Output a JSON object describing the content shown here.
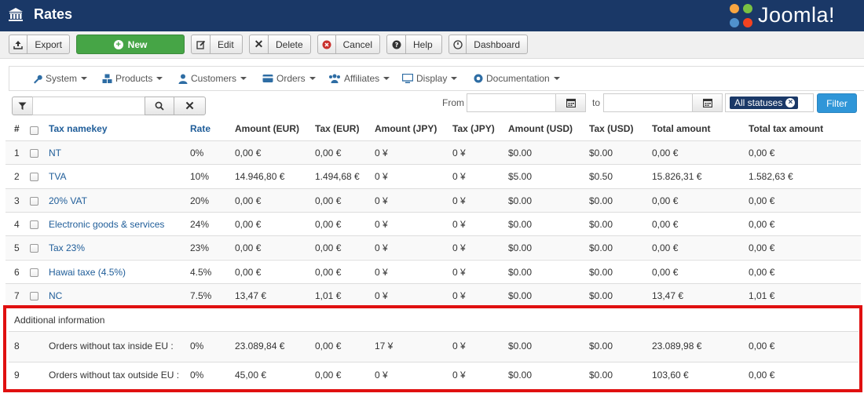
{
  "header": {
    "title": "Rates",
    "logo_text": "Joomla!"
  },
  "toolbar": {
    "export": "Export",
    "new": "New",
    "edit": "Edit",
    "delete": "Delete",
    "cancel": "Cancel",
    "help": "Help",
    "dashboard": "Dashboard"
  },
  "menu": {
    "system": "System",
    "products": "Products",
    "customers": "Customers",
    "orders": "Orders",
    "affiliates": "Affiliates",
    "display": "Display",
    "documentation": "Documentation"
  },
  "filters": {
    "search_value": "",
    "from_label": "From",
    "to_label": "to",
    "from_value": "",
    "to_value": "",
    "status_chip": "All statuses",
    "filter_button": "Filter"
  },
  "table": {
    "columns": [
      "#",
      "Tax namekey",
      "Rate",
      "Amount (EUR)",
      "Tax (EUR)",
      "Amount (JPY)",
      "Tax (JPY)",
      "Amount (USD)",
      "Tax (USD)",
      "Total amount",
      "Total tax amount"
    ],
    "rows": [
      [
        "1",
        "NT",
        "0%",
        "0,00 €",
        "0,00 €",
        "0 ¥",
        "0 ¥",
        "$0.00",
        "$0.00",
        "0,00 €",
        "0,00 €"
      ],
      [
        "2",
        "TVA",
        "10%",
        "14.946,80 €",
        "1.494,68 €",
        "0 ¥",
        "0 ¥",
        "$5.00",
        "$0.50",
        "15.826,31 €",
        "1.582,63 €"
      ],
      [
        "3",
        "20% VAT",
        "20%",
        "0,00 €",
        "0,00 €",
        "0 ¥",
        "0 ¥",
        "$0.00",
        "$0.00",
        "0,00 €",
        "0,00 €"
      ],
      [
        "4",
        "Electronic goods & services",
        "24%",
        "0,00 €",
        "0,00 €",
        "0 ¥",
        "0 ¥",
        "$0.00",
        "$0.00",
        "0,00 €",
        "0,00 €"
      ],
      [
        "5",
        "Tax 23%",
        "23%",
        "0,00 €",
        "0,00 €",
        "0 ¥",
        "0 ¥",
        "$0.00",
        "$0.00",
        "0,00 €",
        "0,00 €"
      ],
      [
        "6",
        "Hawai taxe (4.5%)",
        "4.5%",
        "0,00 €",
        "0,00 €",
        "0 ¥",
        "0 ¥",
        "$0.00",
        "$0.00",
        "0,00 €",
        "0,00 €"
      ],
      [
        "7",
        "NC",
        "7.5%",
        "13,47 €",
        "1,01 €",
        "0 ¥",
        "0 ¥",
        "$0.00",
        "$0.00",
        "13,47 €",
        "1,01 €"
      ]
    ],
    "additional_title": "Additional information",
    "additional_rows": [
      [
        "8",
        "Orders without tax inside EU :",
        "0%",
        "23.089,84 €",
        "0,00 €",
        "17 ¥",
        "0 ¥",
        "$0.00",
        "$0.00",
        "23.089,98 €",
        "0,00 €"
      ],
      [
        "9",
        "Orders without tax outside EU :",
        "0%",
        "45,00 €",
        "0,00 €",
        "0 ¥",
        "0 ¥",
        "$0.00",
        "$0.00",
        "103,60 €",
        "0,00 €"
      ]
    ]
  },
  "colors": {
    "header_bg": "#1a3867",
    "new_button": "#46a546",
    "filter_button": "#2f96d8",
    "link": "#1f5d99",
    "highlight_border": "#e01010"
  }
}
